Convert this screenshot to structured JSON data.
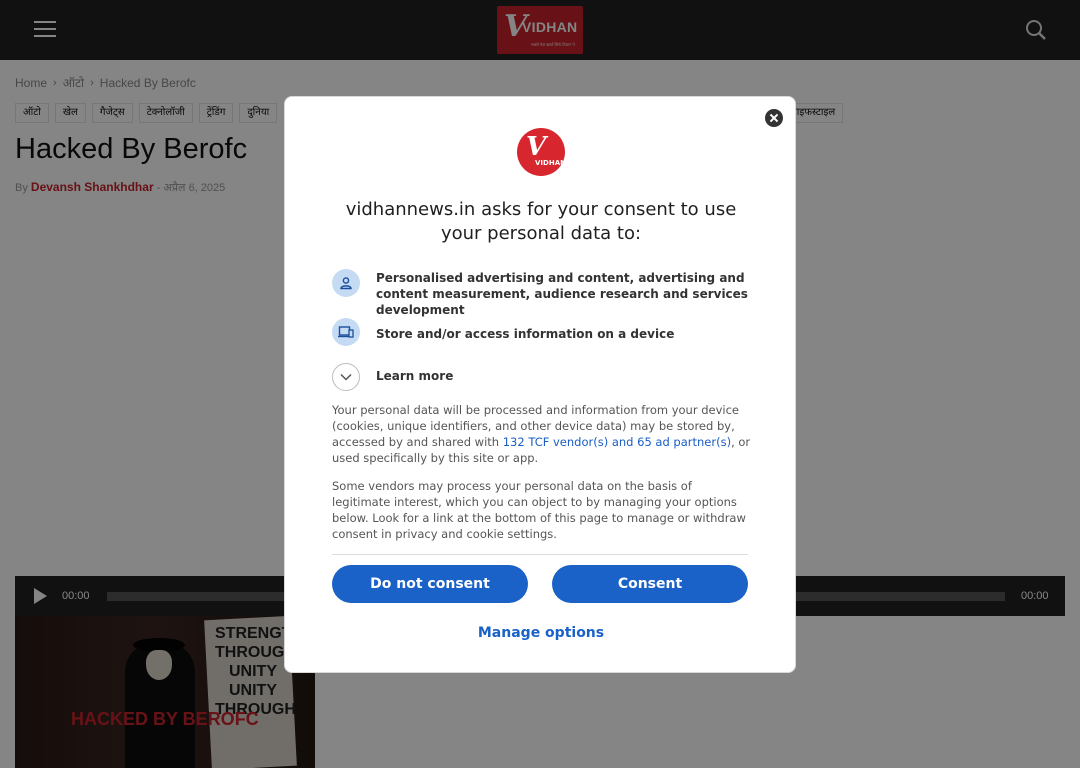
{
  "header": {
    "logo_word": "VIDHAN",
    "logo_letter": "V",
    "logo_tagline": "सबसे तेज़ खबरें सिर्फ विधान पे"
  },
  "breadcrumb": [
    "Home",
    "ऑटो",
    "Hacked By Berofc"
  ],
  "tags": [
    "ऑटो",
    "खेल",
    "गैजेट्स",
    "टेक्नोलॉजी",
    "ट्रेंडिंग",
    "दुनिया"
  ],
  "tag_right": "लाइफस्टाइल",
  "article": {
    "title": "Hacked By Berofc",
    "by": "By",
    "author": "Devansh Shankhdhar",
    "date": "- अप्रैल 6, 2025"
  },
  "audio": {
    "current": "00:00",
    "duration": "00:00"
  },
  "hero": {
    "sign_text": "STRENGTH THROUGH UNITY UNITY THROUGH",
    "overlay_text": "HACKED BY BEROFC"
  },
  "consent": {
    "logo_letter": "V",
    "logo_word": "VIDHAN",
    "heading": "vidhannews.in asks for your consent to use your personal data to:",
    "purposes": [
      {
        "icon": "person-icon",
        "text": "Personalised advertising and content, advertising and content measurement, audience research and services development"
      },
      {
        "icon": "device-icon",
        "text": "Store and/or access information on a device"
      }
    ],
    "learn_more": "Learn more",
    "para1_before": "Your personal data will be processed and information from your device (cookies, unique identifiers, and other device data) may be stored by, accessed by and shared with ",
    "para1_link": "132 TCF vendor(s) and 65 ad partner(s)",
    "para1_after": ", or used specifically by this site or app.",
    "para2": "Some vendors may process your personal data on the basis of legitimate interest, which you can object to by managing your options below. Look for a link at the bottom of this page to manage or withdraw consent in privacy and cookie settings.",
    "do_not_consent": "Do not consent",
    "consent": "Consent",
    "manage": "Manage options"
  },
  "colors": {
    "brand_red": "#c8232c",
    "consent_blue": "#1a62c8",
    "top_bar": "#222222"
  }
}
